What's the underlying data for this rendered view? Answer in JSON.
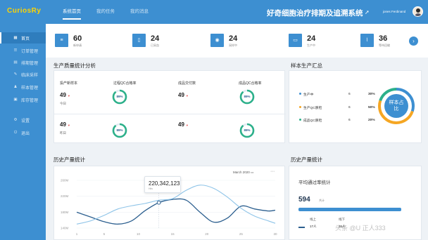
{
  "header": {
    "logo": "CuriosRy",
    "nav": [
      "系统首页",
      "我的任务",
      "我的消息"
    ],
    "system_title": "好奇细胞治疗排期及追溯系统",
    "user_name": "jones Ferdinand",
    "brand_color": "#3d8fd1"
  },
  "sidebar": {
    "items": [
      {
        "icon": "home-icon",
        "label": "首页"
      },
      {
        "icon": "list-icon",
        "label": "订单管理"
      },
      {
        "icon": "calendar-icon",
        "label": "排期管理"
      },
      {
        "icon": "sample-icon",
        "label": "临床采样"
      },
      {
        "icon": "user-icon",
        "label": "样本管理"
      },
      {
        "icon": "inventory-icon",
        "label": "库存管理"
      },
      {
        "icon": "settings-icon",
        "label": "设置"
      },
      {
        "icon": "logout-icon",
        "label": "退出"
      }
    ]
  },
  "stats": [
    {
      "icon": "document-icon",
      "value": "60",
      "label": "新申请"
    },
    {
      "icon": "clipboard-icon",
      "value": "24",
      "label": "已采血"
    },
    {
      "icon": "eye-icon",
      "value": "24",
      "label": "采样中"
    },
    {
      "icon": "tray-icon",
      "value": "24",
      "label": "生产中"
    },
    {
      "icon": "chart-icon",
      "value": "36",
      "label": "等待回输"
    }
  ],
  "quality": {
    "title": "生产质量统计分析",
    "headers": [
      "投产新样本",
      "过程QC合格率",
      "成品交付数",
      "成品QC合格率"
    ],
    "rows": [
      {
        "value1": "49",
        "sub": "今日",
        "ring1": "89%",
        "value2": "49",
        "ring2": "89%"
      },
      {
        "value1": "49",
        "sub": "昨日",
        "ring1": "89%",
        "value2": "49",
        "ring2": "89%"
      }
    ],
    "ring_fraction": 0.89
  },
  "summary": {
    "title": "样本生产汇总",
    "items": [
      {
        "label": "生产中",
        "count": "6",
        "pct": "30%",
        "color": "#3d8fd1"
      },
      {
        "label": "生产QC质检",
        "count": "6",
        "pct": "50%",
        "color": "#f5a623"
      },
      {
        "label": "成品QC质检",
        "count": "6",
        "pct": "20%",
        "color": "#2cb08a"
      }
    ],
    "center_label": "样本占比"
  },
  "history": {
    "title": "历史产量统计",
    "month": "March 2020",
    "tooltip_value": "220,342,123",
    "tooltip_sub": "Hits"
  },
  "chart_data": {
    "type": "line",
    "x": [
      1,
      3,
      5,
      7,
      9,
      11,
      13,
      15,
      17,
      19,
      21,
      23,
      25,
      27,
      29,
      30
    ],
    "xticks": [
      "1",
      "5",
      "10",
      "15",
      "20",
      "25",
      "30"
    ],
    "yticks": [
      "260M",
      "220M",
      "180M",
      "140M"
    ],
    "ylim": [
      140,
      260
    ],
    "series": [
      {
        "values": [
          180,
          168,
          156,
          150,
          158,
          184,
          204,
          212,
          210,
          180,
          155,
          165,
          195,
          188,
          183,
          185
        ]
      },
      {
        "values": [
          150,
          158,
          172,
          188,
          196,
          202,
          210,
          214,
          235,
          248,
          240,
          218,
          190,
          170,
          158,
          152
        ]
      }
    ],
    "highlight": {
      "x": 13,
      "y": 204
    },
    "colors": [
      "#2c5f8f",
      "#8ec4e8"
    ]
  },
  "hstats": {
    "title": "历史产量统计",
    "subtitle": "平均通过率统计",
    "big_value": "594",
    "big_unit": "共计",
    "progress": 1.0,
    "k1": "线上",
    "v1": "17人",
    "k2": "线下",
    "v2": "36人"
  },
  "watermark": "头条 @U 正人333"
}
